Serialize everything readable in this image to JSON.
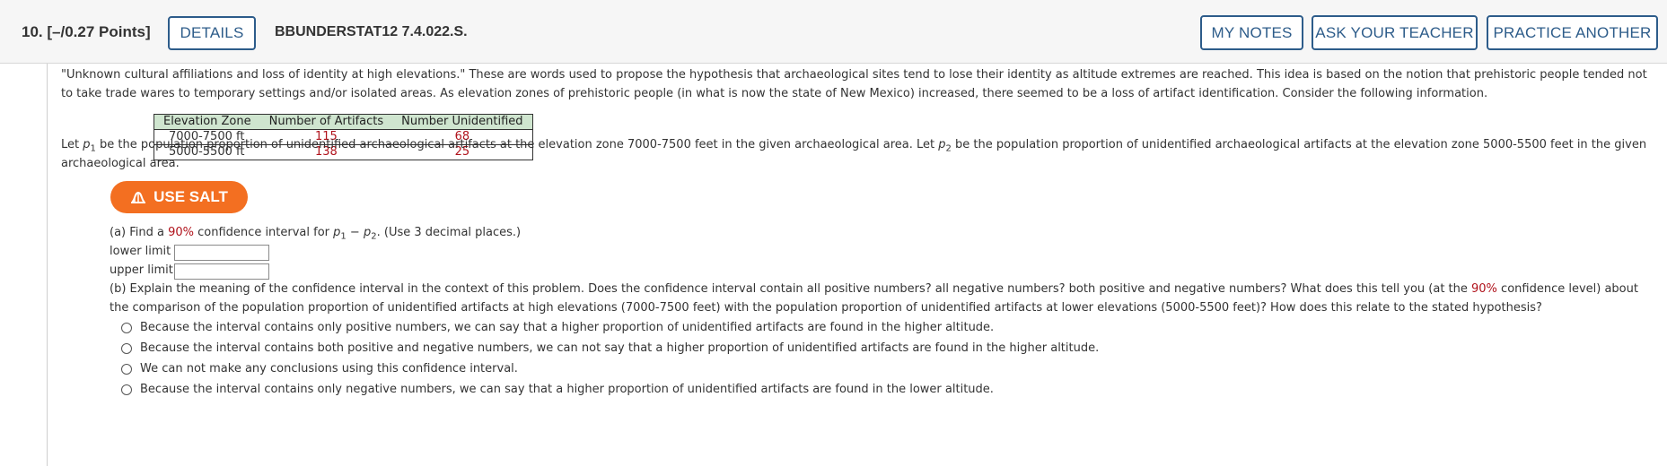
{
  "header": {
    "question_number": "10.",
    "points": "[–/0.27 Points]",
    "details_label": "DETAILS",
    "question_code": "BBUNDERSTAT12 7.4.022.S.",
    "my_notes_label": "MY NOTES",
    "ask_teacher_label": "ASK YOUR TEACHER",
    "practice_label": "PRACTICE ANOTHER"
  },
  "intro": {
    "line1": "\"Unknown cultural affiliations and loss of identity at high elevations.\" These are words used to propose the hypothesis that archaeological sites tend to lose their identity as altitude extremes are reached. This idea is based on the notion that prehistoric people tended not",
    "line2": "to take trade wares to temporary settings and/or isolated areas. As elevation zones of prehistoric people (in what is now the state of New Mexico) increased, there seemed to be a loss of artifact identification. Consider the following information."
  },
  "table": {
    "headers": [
      "Elevation Zone",
      "Number of Artifacts",
      "Number Unidentified"
    ],
    "rows": [
      {
        "zone": "7000-7500 ft",
        "artifacts": "115",
        "unidentified": "68"
      },
      {
        "zone": "5000-5500 ft",
        "artifacts": "138",
        "unidentified": "25"
      }
    ]
  },
  "definition": {
    "let": "Let",
    "p": "p",
    "sub1": "1",
    "sub2": "2",
    "text1": " be the population proportion of unidentified archaeological artifacts at the elevation zone 7000-7500 feet in the given archaeological area. Let ",
    "text2": " be the population proportion of unidentified archaeological artifacts at the elevation zone 5000-5500 feet in the given",
    "line2": "archaeological area."
  },
  "salt_button": "USE SALT",
  "part_a": {
    "prefix": "(a) Find a ",
    "confidence": "90%",
    "middle": " confidence interval for ",
    "minus": " − ",
    "suffix": ". (Use 3 decimal places.)",
    "lower_label": "lower limit",
    "upper_label": "upper limit",
    "lower_value": "",
    "upper_value": ""
  },
  "part_b": {
    "line1_start": "(b) Explain the meaning of the confidence interval in the context of this problem. Does the confidence interval contain all positive numbers? all negative numbers? both positive and negative numbers? What does this tell you (at the ",
    "confidence": "90%",
    "line1_end": " confidence level) about",
    "line2": "the comparison of the population proportion of unidentified artifacts at high elevations (7000-7500 feet) with the population proportion of unidentified artifacts at lower elevations (5000-5500 feet)? How does this relate to the stated hypothesis?",
    "options": [
      "Because the interval contains only positive numbers, we can say that a higher proportion of unidentified artifacts are found in the higher altitude.",
      "Because the interval contains both positive and negative numbers, we can not say that a higher proportion of unidentified artifacts are found in the higher altitude.",
      "We can not make any conclusions using this confidence interval.",
      "Because the interval contains only negative numbers, we can say that a higher proportion of unidentified artifacts are found in the lower altitude."
    ]
  }
}
